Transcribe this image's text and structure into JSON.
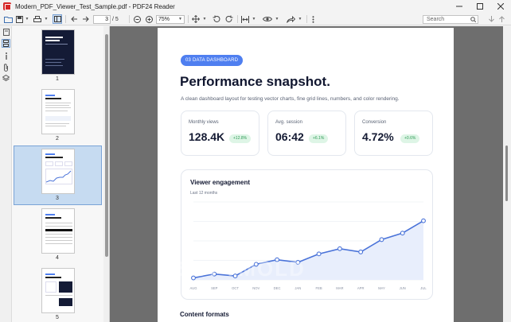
{
  "window": {
    "filename": "Modern_PDF_Viewer_Test_Sample.pdf",
    "app_name": "PDF24 Reader",
    "title_sep": " - "
  },
  "toolbar": {
    "current_page": "3",
    "page_total": "/ 5",
    "zoom": "75%",
    "search_placeholder": "Search"
  },
  "thumbnails": {
    "labels": [
      "1",
      "2",
      "3",
      "4",
      "5"
    ],
    "selected": 3
  },
  "document": {
    "tag": "03  DATA DASHBOARD",
    "title": "Performance snapshot.",
    "subtitle": "A clean dashboard layout for testing vector charts, fine grid lines, numbers, and color rendering.",
    "kpis": [
      {
        "label": "Monthly views",
        "value": "128.4K",
        "delta": "+12.8%"
      },
      {
        "label": "Avg. session",
        "value": "06:42",
        "delta": "+6.1%"
      },
      {
        "label": "Conversion",
        "value": "4.72%",
        "delta": "+0.6%"
      }
    ],
    "chart_title": "Viewer engagement",
    "chart_subtitle": "Last 12 months",
    "next_section": "Content formats"
  },
  "chart_data": {
    "type": "area",
    "title": "Viewer engagement",
    "subtitle": "Last 12 months",
    "categories": [
      "AUG",
      "SEP",
      "OCT",
      "NOV",
      "DEC",
      "JAN",
      "FEB",
      "MAR",
      "APR",
      "MAY",
      "JUN",
      "JUL"
    ],
    "series": [
      {
        "values": [
          3,
          9,
          6,
          24,
          31,
          27,
          40,
          48,
          43,
          62,
          72,
          91
        ]
      }
    ],
    "ylim": [
      0,
      120
    ],
    "grid": true,
    "color": "#4a73d9",
    "fill": "#e8eefc"
  },
  "colors": {
    "accent": "#4f7ff0",
    "badge_bg": "#def5e6",
    "badge_text": "#2e9b55",
    "viewer_bg": "#6e6e6e"
  },
  "watermark": "SOFTMOLD"
}
